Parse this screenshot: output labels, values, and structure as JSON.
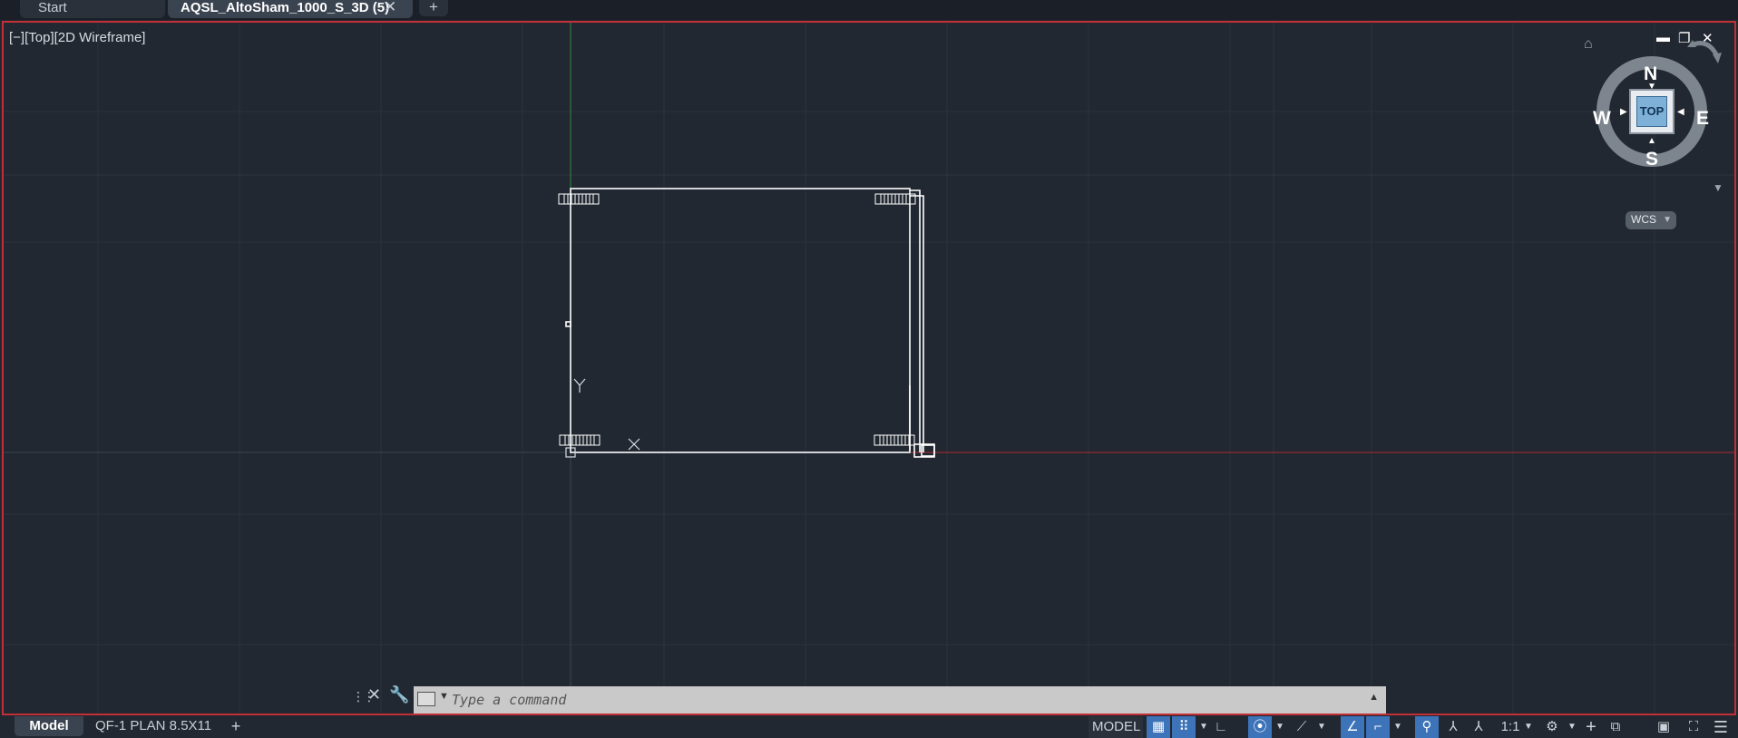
{
  "tabs": {
    "start_label": "Start",
    "document_label": "AQSL_AltoSham_1000_S_3D (5)",
    "close_glyph": "✕",
    "add_glyph": "+"
  },
  "viewport": {
    "label": "[−][Top][2D Wireframe]",
    "controls": {
      "minimize": "▬",
      "restore": "❐",
      "close": "✕"
    }
  },
  "viewcube": {
    "face": "TOP",
    "north": "N",
    "south": "S",
    "east": "E",
    "west": "W",
    "ucs_label": "WCS"
  },
  "drawing": {
    "ucs_y": "Y",
    "ucs_x": "X",
    "colors": {
      "line": "#ffffff",
      "x_axis": "#b02a2f",
      "y_axis": "#2e8c3e",
      "grid": "#2a323c"
    }
  },
  "command_line": {
    "placeholder": "Type a command",
    "value": ""
  },
  "layout_tabs": [
    "Model",
    "QF-1 PLAN 8.5X11"
  ],
  "status_bar": {
    "model_label": "MODEL",
    "scale_label": "1:1"
  },
  "icons": {
    "home": "home-icon",
    "settings": "gear-icon",
    "customize": "menu-icon"
  }
}
